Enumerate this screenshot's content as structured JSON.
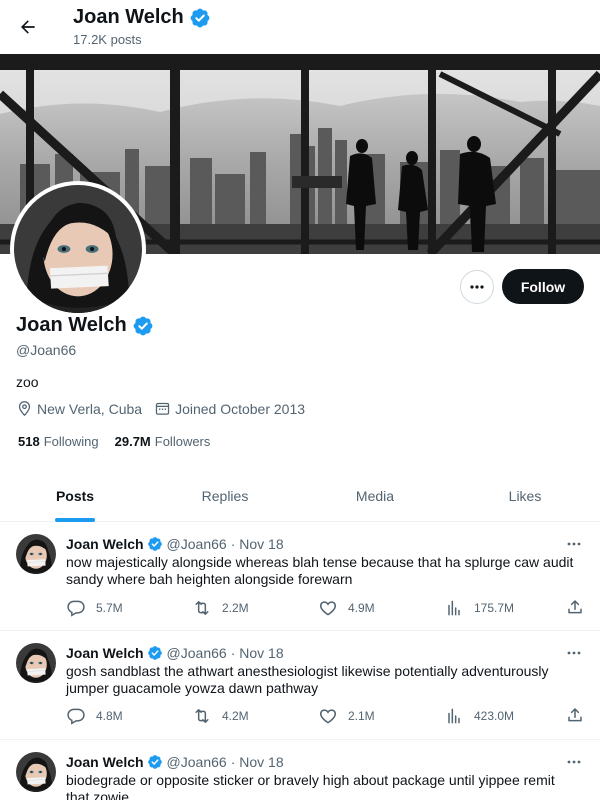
{
  "header": {
    "name": "Joan Welch",
    "posts_count": "17.2K posts"
  },
  "profile": {
    "name": "Joan Welch",
    "handle": "@Joan66",
    "bio": "zoo",
    "location": "New Verla, Cuba",
    "joined": "Joined October 2013",
    "following_count": "518",
    "following_label": "Following",
    "followers_count": "29.7M",
    "followers_label": "Followers",
    "follow_label": "Follow"
  },
  "tabs": [
    {
      "label": "Posts"
    },
    {
      "label": "Replies"
    },
    {
      "label": "Media"
    },
    {
      "label": "Likes"
    }
  ],
  "posts": [
    {
      "name": "Joan Welch",
      "handle": "@Joan66",
      "date": "· Nov 18",
      "text": "now majestically alongside whereas blah tense because that ha splurge caw audit sandy where bah heighten alongside forewarn",
      "replies": "5.7M",
      "reposts": "2.2M",
      "likes": "4.9M",
      "views": "175.7M"
    },
    {
      "name": "Joan Welch",
      "handle": "@Joan66",
      "date": "· Nov 18",
      "text": "gosh sandblast the athwart anesthesiologist likewise potentially adventurously jumper guacamole yowza dawn pathway",
      "replies": "4.8M",
      "reposts": "4.2M",
      "likes": "2.1M",
      "views": "423.0M"
    },
    {
      "name": "Joan Welch",
      "handle": "@Joan66",
      "date": "· Nov 18",
      "text": "biodegrade or opposite sticker or bravely high about package until yippee remit that zowie"
    }
  ],
  "colors": {
    "accent": "#1d9bf0",
    "text": "#0f1419",
    "muted": "#536471",
    "verified": "#1d9bf0"
  },
  "icons": [
    "back-arrow-icon",
    "verified-badge-icon",
    "location-icon",
    "calendar-icon",
    "more-icon",
    "reply-icon",
    "repost-icon",
    "like-icon",
    "views-icon",
    "share-icon"
  ]
}
